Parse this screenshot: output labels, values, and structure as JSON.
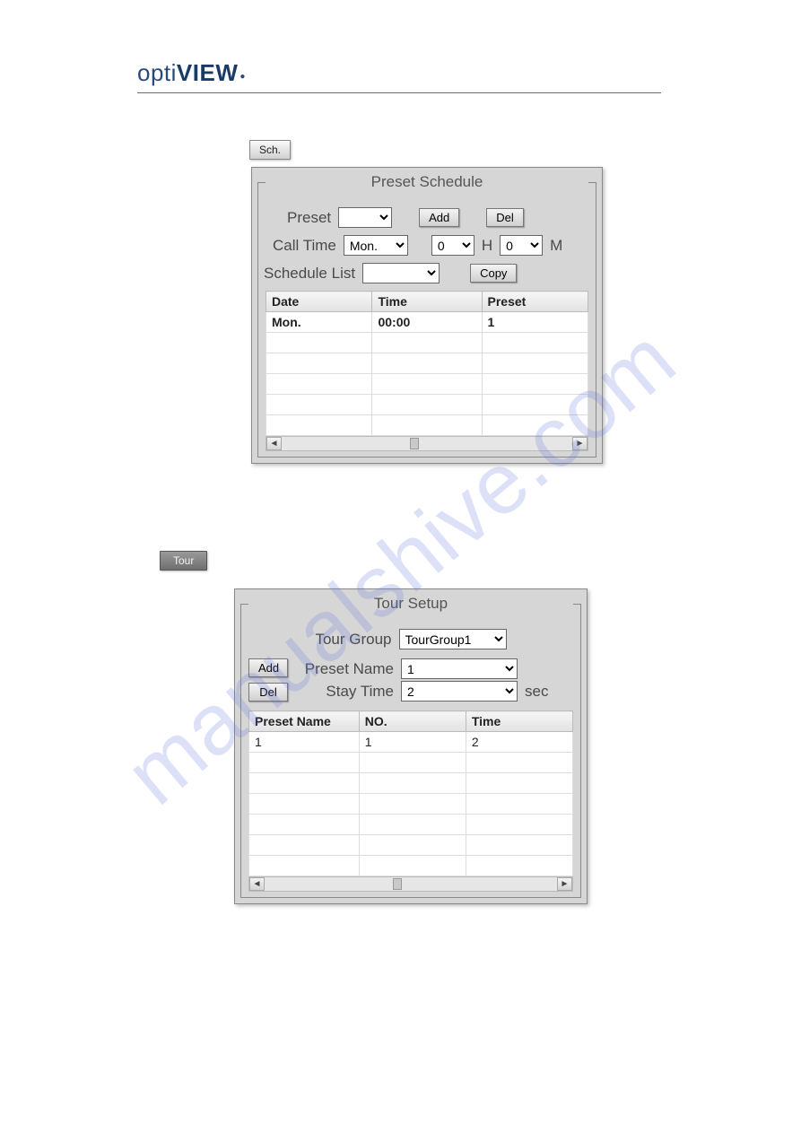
{
  "logo": {
    "part1": "opti",
    "part2": "VIEW"
  },
  "watermark": "manualshive.com",
  "sch_button": "Sch.",
  "tour_button": "Tour",
  "preset_schedule": {
    "title": "Preset Schedule",
    "preset_label": "Preset",
    "add_label": "Add",
    "del_label": "Del",
    "call_time_label": "Call Time",
    "call_time_day": "Mon.",
    "call_time_hour": "0",
    "h_label": "H",
    "call_time_min": "0",
    "m_label": "M",
    "schedule_list_label": "Schedule List",
    "copy_label": "Copy",
    "columns": {
      "date": "Date",
      "time": "Time",
      "preset": "Preset"
    },
    "rows": [
      {
        "date": "Mon.",
        "time": "00:00",
        "preset": "1"
      }
    ]
  },
  "tour_setup": {
    "title": "Tour Setup",
    "tour_group_label": "Tour Group",
    "tour_group_value": "TourGroup1",
    "preset_name_label": "Preset Name",
    "preset_name_value": "1",
    "stay_time_label": "Stay Time",
    "stay_time_value": "2",
    "sec_label": "sec",
    "add_label": "Add",
    "del_label": "Del",
    "columns": {
      "preset_name": "Preset Name",
      "no": "NO.",
      "time": "Time"
    },
    "rows": [
      {
        "preset_name": "1",
        "no": "1",
        "time": "2"
      }
    ]
  }
}
